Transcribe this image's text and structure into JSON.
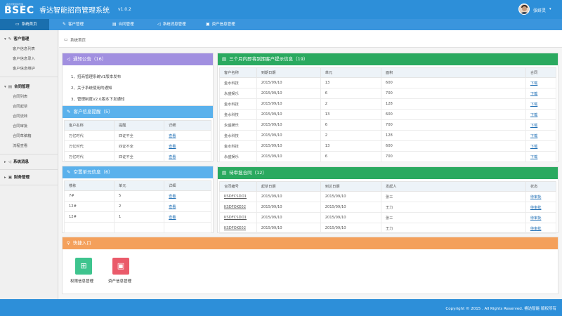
{
  "header": {
    "logo_small": "睿达智能招商管理",
    "logo_text": "BSEC",
    "title": "睿达智能招商管理系统",
    "version": "v1.0.2",
    "user_name": "张妍灵",
    "user_caret": "▾"
  },
  "nav": {
    "items": [
      {
        "label": "系统首页",
        "icon": "monitor-icon",
        "glyph": "▭"
      },
      {
        "label": "客户管理",
        "icon": "user-edit-icon",
        "glyph": "✎"
      },
      {
        "label": "合同管理",
        "icon": "document-icon",
        "glyph": "▤"
      },
      {
        "label": "系统消息管理",
        "icon": "speaker-icon",
        "glyph": "◁"
      },
      {
        "label": "资产信息管理",
        "icon": "briefcase-icon",
        "glyph": "▣"
      }
    ]
  },
  "sidebar": {
    "groups": [
      {
        "label": "客户管理",
        "caret": "▾",
        "glyph": "✎",
        "items": [
          "客户信息列表",
          "客户信息录入",
          "客户信息维护"
        ]
      },
      {
        "label": "合同管理",
        "caret": "▾",
        "glyph": "▤",
        "items": [
          "合同列表",
          "合同起草",
          "合同流转",
          "合同审批",
          "合同草稿箱",
          "流程查看"
        ]
      },
      {
        "label": "系统消息",
        "caret": "▸",
        "glyph": "◁",
        "items": []
      },
      {
        "label": "财务管理",
        "caret": "▸",
        "glyph": "▣",
        "items": []
      }
    ]
  },
  "breadcrumb": {
    "icon": "monitor-icon",
    "glyph": "▭",
    "label": "系统首页"
  },
  "panels": {
    "notice": {
      "title": "通知公告（16）",
      "glyph": "◁",
      "items": [
        "1、招商管理系统V1版本发布",
        "2、关于系统使用的通知",
        "3、管理制度V2.0版本下发通知"
      ]
    },
    "customer_alert": {
      "title": "客户信息提醒（5）",
      "glyph": "✎",
      "columns": [
        "客户名称",
        "提醒",
        "详细"
      ],
      "rows": [
        [
          "万亿时代",
          "四证不全",
          "查看"
        ],
        [
          "万亿时代",
          "四证不全",
          "查看"
        ],
        [
          "万亿时代",
          "四证不全",
          "查看"
        ]
      ]
    },
    "vacant_units": {
      "title": "空置单元信息（6）",
      "glyph": "✎",
      "columns": [
        "楼栋",
        "单元",
        "详细"
      ],
      "rows": [
        [
          "7#",
          "5",
          "查看"
        ],
        [
          "12#",
          "2",
          "查看"
        ],
        [
          "12#",
          "1",
          "查看"
        ],
        [
          "",
          "",
          ""
        ]
      ]
    },
    "expiring": {
      "title": "三个月内即将到期客户提示信息（19）",
      "glyph": "▤",
      "columns": [
        "客户名称",
        "到期日期",
        "单元",
        "面积",
        "合同"
      ],
      "rows": [
        [
          "金水科技",
          "2015/09/10",
          "13",
          "600",
          "下载"
        ],
        [
          "永盛娱乐",
          "2015/09/10",
          "6",
          "700",
          "下载"
        ],
        [
          "金水科技",
          "2015/09/10",
          "2",
          "128",
          "下载"
        ],
        [
          "金水科技",
          "2015/09/10",
          "13",
          "600",
          "下载"
        ],
        [
          "永盛娱乐",
          "2015/09/10",
          "6",
          "700",
          "下载"
        ],
        [
          "金水科技",
          "2015/09/10",
          "2",
          "128",
          "下载"
        ],
        [
          "金水科技",
          "2015/09/10",
          "13",
          "600",
          "下载"
        ],
        [
          "永盛娱乐",
          "2015/09/10",
          "6",
          "700",
          "下载"
        ]
      ]
    },
    "pending_contracts": {
      "title": "待审批合同（12）",
      "glyph": "▤",
      "columns": [
        "合同编号",
        "起草日期",
        "到达日期",
        "发起人",
        "状态"
      ],
      "rows": [
        [
          "KSDFCSDO1",
          "2015/09/10",
          "2015/09/10",
          "张三",
          "待审批"
        ],
        [
          "KSDFOKE02",
          "2015/09/10",
          "2015/09/10",
          "王力",
          "待审批"
        ],
        [
          "KSDFCSDO1",
          "2015/09/10",
          "2015/09/10",
          "张三",
          "待审批"
        ],
        [
          "KSDFOKE02",
          "2015/09/10",
          "2015/09/10",
          "王力",
          "待审批"
        ]
      ]
    },
    "quick_links": {
      "title": "快捷入口",
      "glyph": "⚲",
      "items": [
        {
          "label": "权限信息管理",
          "icon": "permissions-icon",
          "glyph": "⊞",
          "color": "#3ec48e"
        },
        {
          "label": "资产信息管理",
          "icon": "briefcase-icon",
          "glyph": "▣",
          "color": "#ea5a6a"
        }
      ]
    }
  },
  "footer": {
    "text": "Copyright © 2015 . All Rights Reserved. 睿达智能 版权所有"
  },
  "colors": {
    "topbar": "#2d8fd9",
    "nav_active": "#1a6fae",
    "purple": "#a18fe0",
    "blue": "#5ab1ec",
    "green": "#2aa95f",
    "orange": "#f4a05b",
    "link": "#1f6fb5"
  }
}
